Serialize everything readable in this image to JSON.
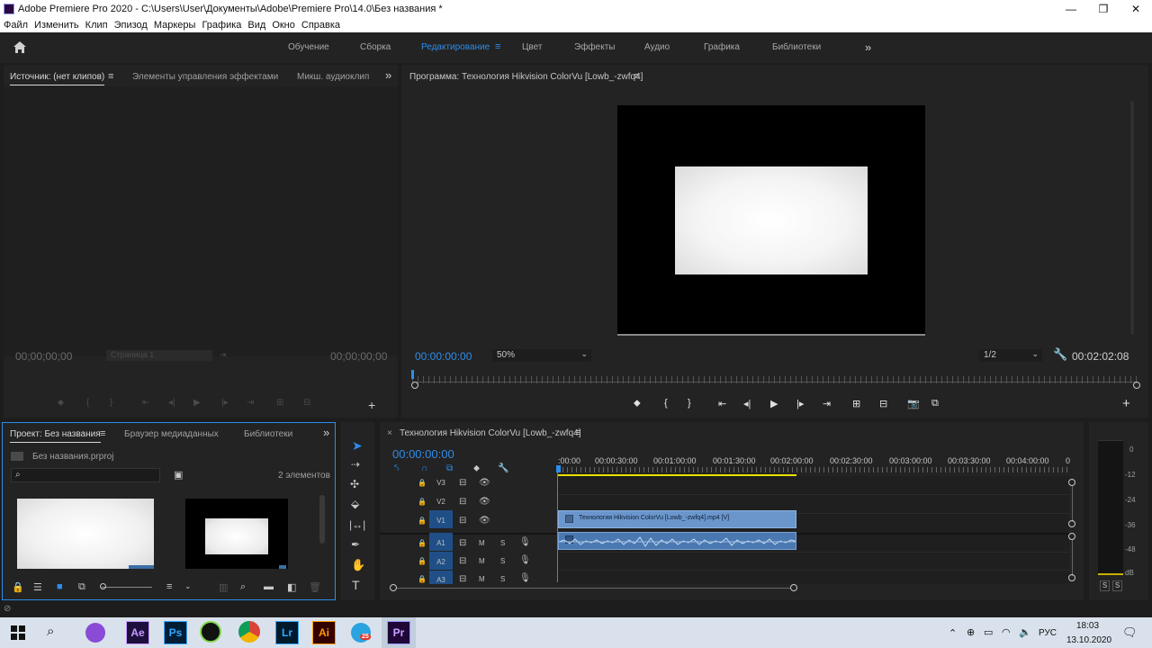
{
  "window": {
    "title": "Adobe Premiere Pro 2020 - C:\\Users\\User\\Документы\\Adobe\\Premiere Pro\\14.0\\Без названия *",
    "minimize": "—",
    "maximize": "❐",
    "close": "✕"
  },
  "menu": [
    "Файл",
    "Изменить",
    "Клип",
    "Эпизод",
    "Маркеры",
    "Графика",
    "Вид",
    "Окно",
    "Справка"
  ],
  "workspaces": {
    "tabs": [
      "Обучение",
      "Сборка",
      "Редактирование",
      "Цвет",
      "Эффекты",
      "Аудио",
      "Графика",
      "Библиотеки"
    ],
    "active": "Редактирование",
    "more": "»"
  },
  "source_panel": {
    "tabs": [
      "Источник: (нет клипов)",
      "Элементы управления эффектами",
      "Микш. аудиоклип"
    ],
    "timecode_left": "00;00;00;00",
    "timecode_right": "00;00;00;00",
    "page_label": "Страница 1",
    "more": "»"
  },
  "program_panel": {
    "title": "Программа: Технология Hikvision ColorVu [Lowb_-zwfq4]",
    "timecode": "00:00:00:00",
    "zoom": "50%",
    "resolution": "1/2",
    "duration": "00:02:02:08"
  },
  "project_panel": {
    "tabs": [
      "Проект: Без названия",
      "Браузер медиаданных",
      "Библиотеки"
    ],
    "file": "Без названия.prproj",
    "count": "2 элементов",
    "search_placeholder": "",
    "more": "»"
  },
  "timeline": {
    "title": "Технология Hikvision ColorVu [Lowb_-zwfq4]",
    "timecode": "00:00:00:00",
    "ruler": [
      ":00:00",
      "00:00:30:00",
      "00:01:00:00",
      "00:01:30:00",
      "00:02:00:00",
      "00:02:30:00",
      "00:03:00:00",
      "00:03:30:00",
      "00:04:00:00",
      "0"
    ],
    "video_tracks": [
      "V3",
      "V2",
      "V1"
    ],
    "audio_tracks": [
      "A1",
      "A2",
      "A3"
    ],
    "clip_label": "Технология Hikvision ColorVu [Lowb_-zwfq4].mp4 [V]",
    "mute": "M",
    "solo": "S"
  },
  "audio_meter": {
    "scale": [
      "0",
      "-12",
      "-24",
      "-36",
      "-48",
      "dB"
    ],
    "solo_left": "S",
    "solo_right": "S"
  },
  "taskbar": {
    "apps": [
      "Ae",
      "Ps",
      "Lr",
      "Ai",
      "Pr"
    ],
    "lang": "РУС",
    "time": "18:03",
    "date": "13.10.2020",
    "badge": "25"
  }
}
